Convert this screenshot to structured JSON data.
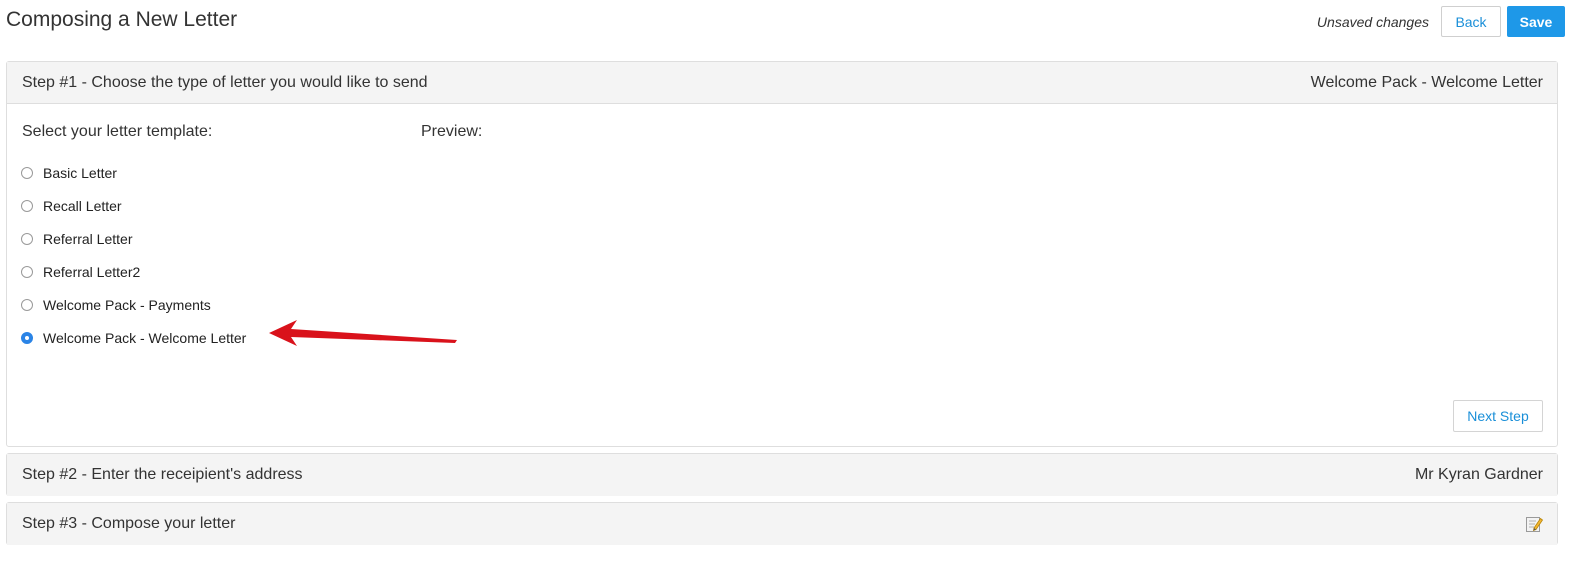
{
  "page": {
    "title": "Composing a New Letter",
    "status": "Unsaved changes",
    "back_label": "Back",
    "save_label": "Save"
  },
  "steps": [
    {
      "title": "Step #1 - Choose the type of letter you would like to send",
      "summary": "Welcome Pack - Welcome Letter",
      "select_label": "Select your letter template:",
      "preview_label": "Preview:",
      "options": [
        {
          "label": "Basic Letter",
          "selected": false
        },
        {
          "label": "Recall Letter",
          "selected": false
        },
        {
          "label": "Referral Letter",
          "selected": false
        },
        {
          "label": "Referral Letter2",
          "selected": false
        },
        {
          "label": "Welcome Pack - Payments",
          "selected": false
        },
        {
          "label": "Welcome Pack - Welcome Letter",
          "selected": true
        }
      ],
      "next_label": "Next Step"
    },
    {
      "title": "Step #2 - Enter the receipient's address",
      "summary": "Mr Kyran Gardner"
    },
    {
      "title": "Step #3 - Compose your letter",
      "icon": "edit-note-icon"
    }
  ],
  "colors": {
    "accent": "#1e98e8",
    "annotation_arrow": "#d9121b"
  }
}
